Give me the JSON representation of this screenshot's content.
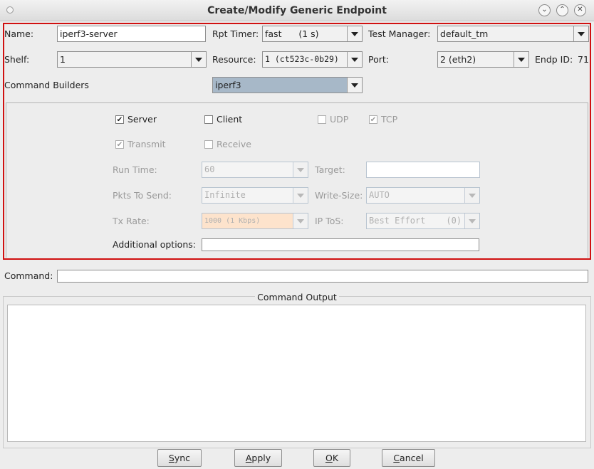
{
  "window": {
    "title": "Create/Modify Generic Endpoint"
  },
  "form": {
    "name_label": "Name:",
    "name_value": "iperf3-server",
    "rpt_timer_label": "Rpt Timer:",
    "rpt_timer_value": "fast      (1 s)",
    "test_manager_label": "Test Manager:",
    "test_manager_value": "default_tm",
    "shelf_label": "Shelf:",
    "shelf_value": "1",
    "resource_label": "Resource:",
    "resource_value": "1 (ct523c-0b29)",
    "port_label": "Port:",
    "port_value": "2 (eth2)",
    "endp_id_label": "Endp ID:",
    "endp_id_value": "71",
    "command_builders_label": "Command Builders",
    "command_builders_value": "iperf3"
  },
  "builder": {
    "server_label": "Server",
    "client_label": "Client",
    "udp_label": "UDP",
    "tcp_label": "TCP",
    "transmit_label": "Transmit",
    "receive_label": "Receive",
    "check_mark": "✔",
    "run_time_label": "Run Time:",
    "run_time_value": "60",
    "target_label": "Target:",
    "target_value": "",
    "pkts_label": "Pkts To Send:",
    "pkts_value": "Infinite",
    "write_size_label": "Write-Size:",
    "write_size_value": "AUTO",
    "tx_rate_label": "Tx Rate:",
    "tx_rate_value": "1000 (1 Kbps)",
    "ip_tos_label": "IP ToS:",
    "ip_tos_value": "Best Effort    (0)",
    "additional_label": "Additional options:",
    "additional_value": ""
  },
  "command": {
    "label": "Command:",
    "value": ""
  },
  "output": {
    "label": "Command Output"
  },
  "buttons": {
    "sync_u": "S",
    "sync_rest": "ync",
    "apply_u": "A",
    "apply_rest": "pply",
    "ok_u": "O",
    "ok_rest": "K",
    "cancel_u": "C",
    "cancel_rest": "ancel"
  },
  "colors": {
    "highlight_border": "#d01010",
    "selected_combo": "#a7b8c8",
    "tx_rate_bg": "#fde3cc"
  }
}
